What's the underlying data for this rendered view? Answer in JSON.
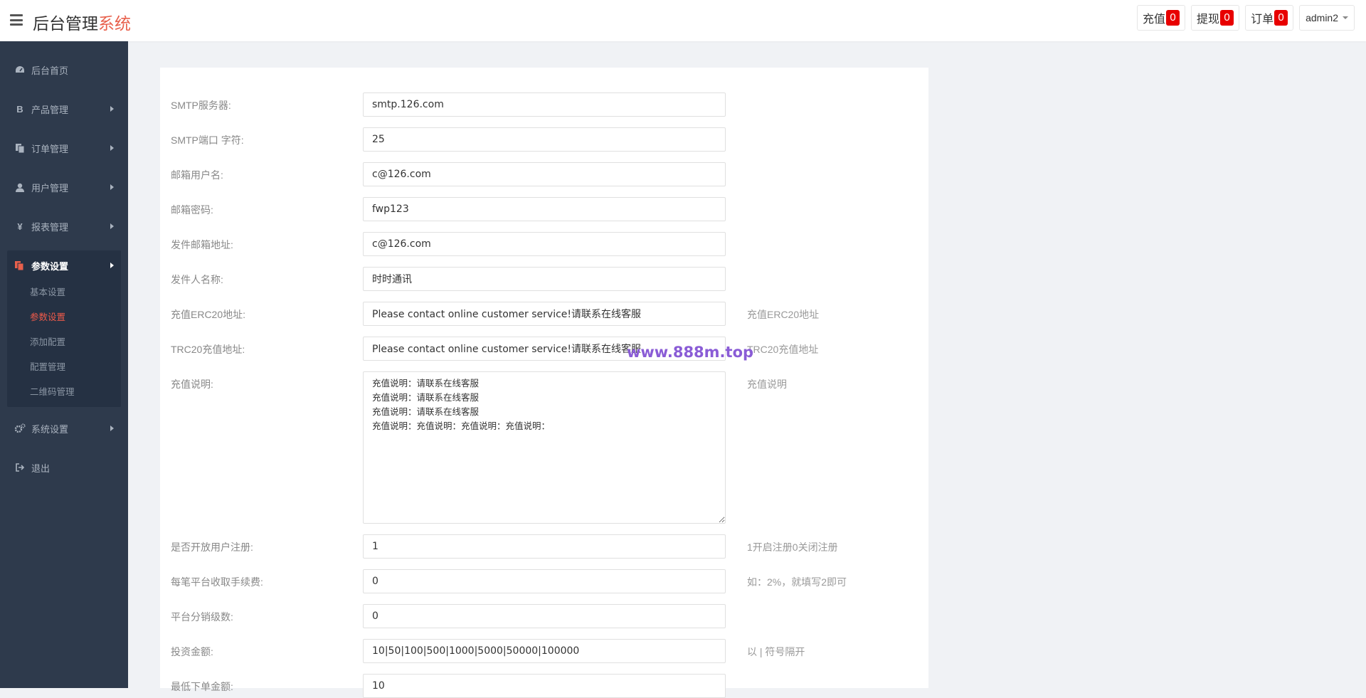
{
  "header": {
    "brand_main": "后台管理",
    "brand_accent": "系统",
    "recharge_label": "充值",
    "recharge_count": "0",
    "withdraw_label": "提现",
    "withdraw_count": "0",
    "orders_label": "订单",
    "orders_count": "0",
    "user_name": "admin2"
  },
  "sidebar": {
    "items": [
      {
        "label": "后台首页",
        "icon": "dashboard-icon"
      },
      {
        "label": "产品管理",
        "icon": "bitcoin-icon"
      },
      {
        "label": "订单管理",
        "icon": "copy-icon"
      },
      {
        "label": "用户管理",
        "icon": "user-icon"
      },
      {
        "label": "报表管理",
        "icon": "yen-icon"
      },
      {
        "label": "参数设置",
        "icon": "files-icon"
      },
      {
        "label": "系统设置",
        "icon": "cogs-icon"
      },
      {
        "label": "退出",
        "icon": "sign-out-icon"
      }
    ],
    "sub_items": [
      "基本设置",
      "参数设置",
      "添加配置",
      "配置管理",
      "二维码管理"
    ],
    "current_sub": "参数设置"
  },
  "form": {
    "rows": [
      {
        "label": "SMTP服务器:",
        "value": "smtp.126.com",
        "hint": ""
      },
      {
        "label": "SMTP端口 字符:",
        "value": "25",
        "hint": ""
      },
      {
        "label": "邮箱用户名:",
        "value": "c@126.com",
        "hint": ""
      },
      {
        "label": "邮箱密码:",
        "value": "fwp123",
        "hint": ""
      },
      {
        "label": "发件邮箱地址:",
        "value": "c@126.com",
        "hint": ""
      },
      {
        "label": "发件人名称:",
        "value": "时时通讯",
        "hint": ""
      },
      {
        "label": "充值ERC20地址:",
        "value": "Please contact online customer service!请联系在线客服",
        "hint": "充值ERC20地址"
      },
      {
        "label": "TRC20充值地址:",
        "value": "Please contact online customer service!请联系在线客服",
        "hint": "TRC20充值地址"
      },
      {
        "label": "充值说明:",
        "value": "充值说明：请联系在线客服\n充值说明：请联系在线客服\n充值说明：请联系在线客服\n充值说明：充值说明：充值说明：充值说明：",
        "hint": "充值说明"
      },
      {
        "label": "是否开放用户注册:",
        "value": "1",
        "hint": "1开启注册0关闭注册"
      },
      {
        "label": "每笔平台收取手续费:",
        "value": "0",
        "hint": "如：2%，就填写2即可"
      },
      {
        "label": "平台分销级数:",
        "value": "0",
        "hint": ""
      },
      {
        "label": "投资金额:",
        "value": "10|50|100|500|1000|5000|50000|100000",
        "hint": "以 | 符号隔开"
      },
      {
        "label": "最低下单金额:",
        "value": "10",
        "hint": ""
      }
    ]
  },
  "watermark": "www.888m.top"
}
